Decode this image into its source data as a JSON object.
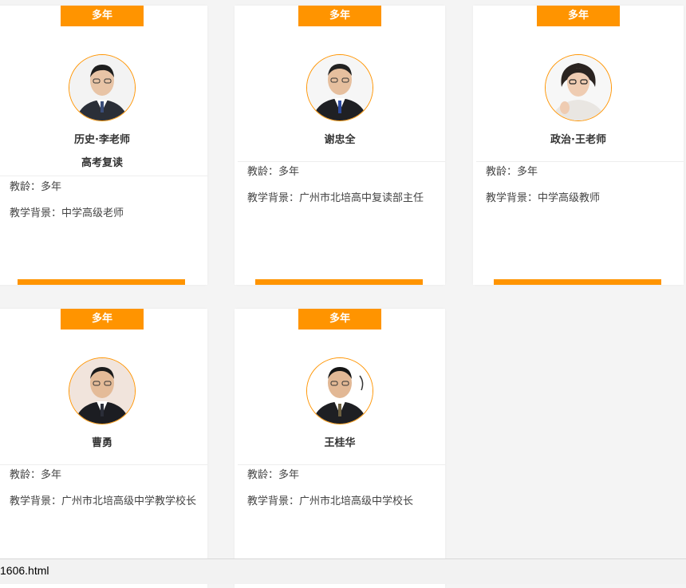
{
  "teachers": [
    {
      "badge": "多年",
      "name": "历史·李老师",
      "subtitle": "高考复读",
      "experience": "教龄：多年",
      "background": "教学背景：中学高级老师"
    },
    {
      "badge": "多年",
      "name": "谢忠全",
      "experience": "教龄：多年",
      "background": "教学背景：广州市北培高中复读部主任"
    },
    {
      "badge": "多年",
      "name": "政治·王老师",
      "experience": "教龄：多年",
      "background": "教学背景：中学高级教师"
    },
    {
      "badge": "多年",
      "name": "曹勇",
      "experience": "教龄：多年",
      "background": "教学背景：广州市北培高级中学教学校长"
    },
    {
      "badge": "多年",
      "name": "王桂华",
      "experience": "教龄：多年",
      "background": "教学背景：广州市北培高级中学校长"
    }
  ],
  "status_bar": {
    "url_text": "1606.html"
  },
  "colors": {
    "accent": "#ff9400",
    "card": "#ffffff",
    "background": "#f4f4f4"
  }
}
